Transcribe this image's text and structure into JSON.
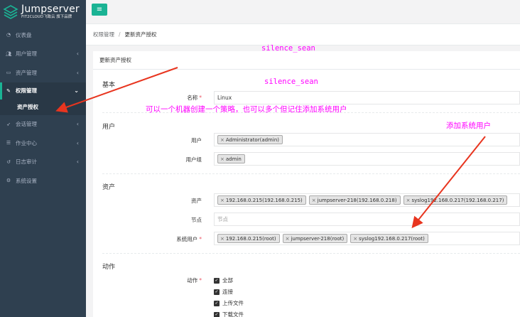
{
  "app": {
    "logo_title": "Jumpserver",
    "logo_sub": "FIT2CLOUD飞致云 旗下品牌"
  },
  "sidebar": {
    "items": [
      {
        "label": "仪表盘",
        "icon": "dashboard-icon",
        "chev": ""
      },
      {
        "label": "用户管理",
        "icon": "users-icon",
        "chev": "‹"
      },
      {
        "label": "资产管理",
        "icon": "inbox-icon",
        "chev": "‹"
      },
      {
        "label": "权限管理",
        "icon": "edit-icon",
        "chev": "⌄"
      },
      {
        "label": "资产授权",
        "icon": "",
        "chev": ""
      },
      {
        "label": "会话管理",
        "icon": "rocket-icon",
        "chev": "‹"
      },
      {
        "label": "作业中心",
        "icon": "tasks-icon",
        "chev": "‹"
      },
      {
        "label": "日志审计",
        "icon": "history-icon",
        "chev": "‹"
      },
      {
        "label": "系统设置",
        "icon": "gears-icon",
        "chev": ""
      }
    ]
  },
  "topbar": {
    "menu_icon": "≡"
  },
  "breadcrumb": {
    "parent": "权限管理",
    "sep": "/",
    "current": "更新资产授权"
  },
  "panel": {
    "title": "更新资产授权",
    "sections": {
      "basic": "基本",
      "user": "用户",
      "asset": "资产",
      "action": "动作"
    },
    "fields": {
      "name_label": "名称",
      "name_value": "Linux",
      "user_label": "用户",
      "user_tags": [
        "Administrator(admin)"
      ],
      "usergroup_label": "用户组",
      "usergroup_tags": [
        "admin"
      ],
      "asset_label": "资产",
      "asset_tags": [
        "192.168.0.215(192.168.0.215)",
        "jumpserver-218(192.168.0.218)",
        "syslog192.168.0.217(192.168.0.217)"
      ],
      "node_label": "节点",
      "node_placeholder": "节点",
      "sysuser_label": "系统用户",
      "sysuser_tags": [
        "192.168.0.215(root)",
        "jumpserver-218(root)",
        "syslog192.168.0.217(root)"
      ],
      "action_label": "动作",
      "actions": [
        "全部",
        "连接",
        "上传文件",
        "下载文件"
      ]
    },
    "required_mark": "*",
    "tag_x": "×"
  },
  "annotations": {
    "watermark1": "silence_sean",
    "watermark2": "silence_sean",
    "note_policy": "可以一个机器创建一个策略，也可以多个但记住添加系统用户",
    "note_sysuser": "添加系统用户"
  },
  "colors": {
    "sidebar_bg": "#2f4050",
    "accent": "#1ab394",
    "annotation_magenta": "#ff00ff",
    "arrow_red": "#e8351f"
  }
}
